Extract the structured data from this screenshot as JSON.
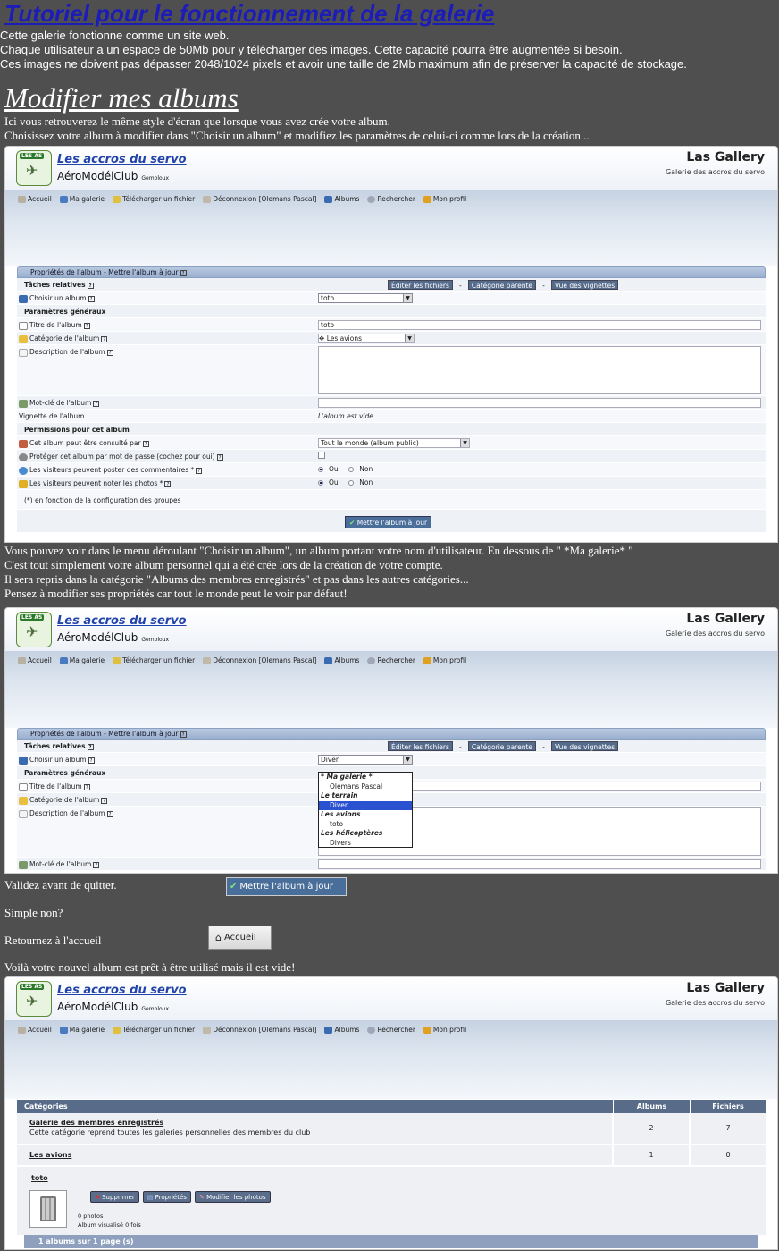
{
  "page": {
    "title": "Tutoriel pour le fonctionnement de la galerie",
    "intro": [
      "Cette galerie fonctionne comme un site web.",
      "Chaque utilisateur a un espace de 50Mb pour y télécharger des images. Cette capacité pourra être augmentée si besoin.",
      "Ces images ne doivent pas dépasser 2048/1024 pixels et avoir une taille de 2Mb maximum afin de préserver la capacité de stockage."
    ],
    "section_title": "Modifier mes albums",
    "para1": [
      "Ici vous retrouverez le même style d'écran que lorsque vous avez crée votre album.",
      "Choisissez votre album à modifier dans \"Choisir un album\" et modifiez les paramètres de celui-ci comme lors de la création..."
    ],
    "para2": [
      "Vous pouvez voir dans le menu déroulant \"Choisir un album\", un album portant votre nom d'utilisateur. En dessous de \" *Ma galerie* \"",
      "C'est tout simplement votre album personnel qui a été crée lors de la création de votre compte.",
      "Il sera repris dans la catégorie \"Albums des membres enregistrés\" et pas dans les autres catégories...",
      "Pensez à modifier ses propriétés car tout le monde peut le voir par défaut!"
    ],
    "validate_text": "Validez avant de quitter.",
    "validate_button": "Mettre l'album à jour",
    "simple_text": "Simple non?",
    "return_text": "Retournez à l'accueil",
    "home_button": "Accueil",
    "final_text": "Voilà votre nouvel album est prêt à être utilisé mais il est vide!"
  },
  "header": {
    "brand_line1": "Les accros du servo",
    "brand_line2": "AéroModélClub",
    "brand_city": "Gembloux",
    "logo_badge": "LES AS",
    "gallery_name": "Las Gallery",
    "gallery_desc": "Galerie des accros du servo"
  },
  "nav": {
    "accueil": "Accueil",
    "ma_galerie": "Ma galerie",
    "telecharger": "Télécharger un fichier",
    "deconnexion1": "Déconnexion [Olemans Pascal]",
    "deconnexion3": "Déconnexion [Olemans Pascal]",
    "albums": "Albums",
    "rechercher": "Rechercher",
    "mon_profil": "Mon profil"
  },
  "form": {
    "panel_title": "Propriétés de l'album - Mettre l'album à jour",
    "taches": "Tâches relatives",
    "editer": "Éditer les fichiers",
    "categorie_parente": "Catégorie parente",
    "vue_vignettes": "Vue des vignettes",
    "choisir_album": "Choisir un album",
    "choisir_value1": "toto",
    "choisir_value2": "Diver",
    "params_generaux": "Paramètres généraux",
    "titre_album": "Titre de l'album",
    "titre_value": "toto",
    "categorie_album": "Catégorie de l'album",
    "categorie_value": "Les avions",
    "description": "Description de l'album",
    "motcle": "Mot-clé de l'album",
    "vignette": "Vignette de l'album",
    "vignette_value": "L'album est vide",
    "permissions": "Permissions pour cet album",
    "consulte_par": "Cet album peut être consulté par",
    "consulte_value": "Tout le monde (album public)",
    "proteger": "Protéger cet album par mot de passe (cochez pour oui)",
    "commentaires": "Les visiteurs peuvent poster des commentaires *",
    "noter": "Les visiteurs peuvent noter les photos *",
    "oui": "Oui",
    "non": "Non",
    "note": "(*) en fonction de la configuration des groupes",
    "update_button": "Mettre l'album à jour"
  },
  "dropdown": [
    {
      "label": "* Ma galerie *",
      "type": "grp"
    },
    {
      "label": "Olemans Pascal",
      "type": "opt"
    },
    {
      "label": "Le terrain",
      "type": "grp"
    },
    {
      "label": "Diver",
      "type": "opt",
      "selected": true
    },
    {
      "label": "Les avions",
      "type": "grp"
    },
    {
      "label": "toto",
      "type": "opt"
    },
    {
      "label": "Les hélicoptères",
      "type": "grp"
    },
    {
      "label": "Divers",
      "type": "opt"
    }
  ],
  "categories": {
    "head_cat": "Catégories",
    "head_albums": "Albums",
    "head_files": "Fichiers",
    "rows": [
      {
        "title": "Galerie des membres enregistrés",
        "desc": "Cette catégorie reprend toutes les galeries personnelles des membres du club",
        "albums": "2",
        "files": "7"
      },
      {
        "title": "Les avions",
        "desc": "",
        "albums": "1",
        "files": "0"
      }
    ],
    "album_name": "toto",
    "btn_supprimer": "Supprimer",
    "btn_proprietes": "Propriétés",
    "btn_modifier": "Modifier les photos",
    "photos": "0 photos",
    "visualise": "Album visualisé 0 fois",
    "footer": "1 albums sur 1 page (s)"
  },
  "colors": {
    "background": "#4f4f4f",
    "title": "#1c1cb8",
    "panel_header": "#586c8a",
    "button": "#4a6e9a"
  }
}
